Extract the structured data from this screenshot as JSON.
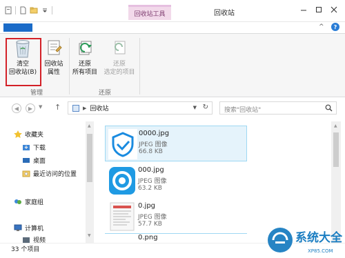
{
  "titlebar": {
    "context_tab": "回收站工具",
    "window_title": "回收站"
  },
  "ribbon": {
    "empty_label_1": "清空",
    "empty_label_2": "回收站(B)",
    "props_label_1": "回收站",
    "props_label_2": "属性",
    "restore_all_1": "还原",
    "restore_all_2": "所有项目",
    "restore_sel_1": "还原",
    "restore_sel_2": "选定的项目",
    "group_manage": "管理",
    "group_restore": "还原",
    "highlight_color": "#d32027"
  },
  "address": {
    "path": "回收站",
    "search_placeholder": "搜索\"回收站\""
  },
  "nav": {
    "favorites": "收藏夹",
    "downloads": "下载",
    "desktop": "桌面",
    "recent": "最近访问的位置",
    "homegroup": "家庭组",
    "computer": "计算机",
    "videos": "视频"
  },
  "files": [
    {
      "name": "0000.jpg",
      "type": "JPEG 图像",
      "size": "66.8 KB",
      "selected": true
    },
    {
      "name": "000.jpg",
      "type": "JPEG 图像",
      "size": "63.2 KB",
      "selected": false
    },
    {
      "name": "0.jpg",
      "type": "JPEG 图像",
      "size": "57.7 KB",
      "selected": false
    },
    {
      "name": "0.png",
      "type": "",
      "size": "",
      "selected": false
    }
  ],
  "status": {
    "count": "33 个项目"
  },
  "watermark": {
    "text": "系统大全",
    "url": "XP85.COM"
  }
}
